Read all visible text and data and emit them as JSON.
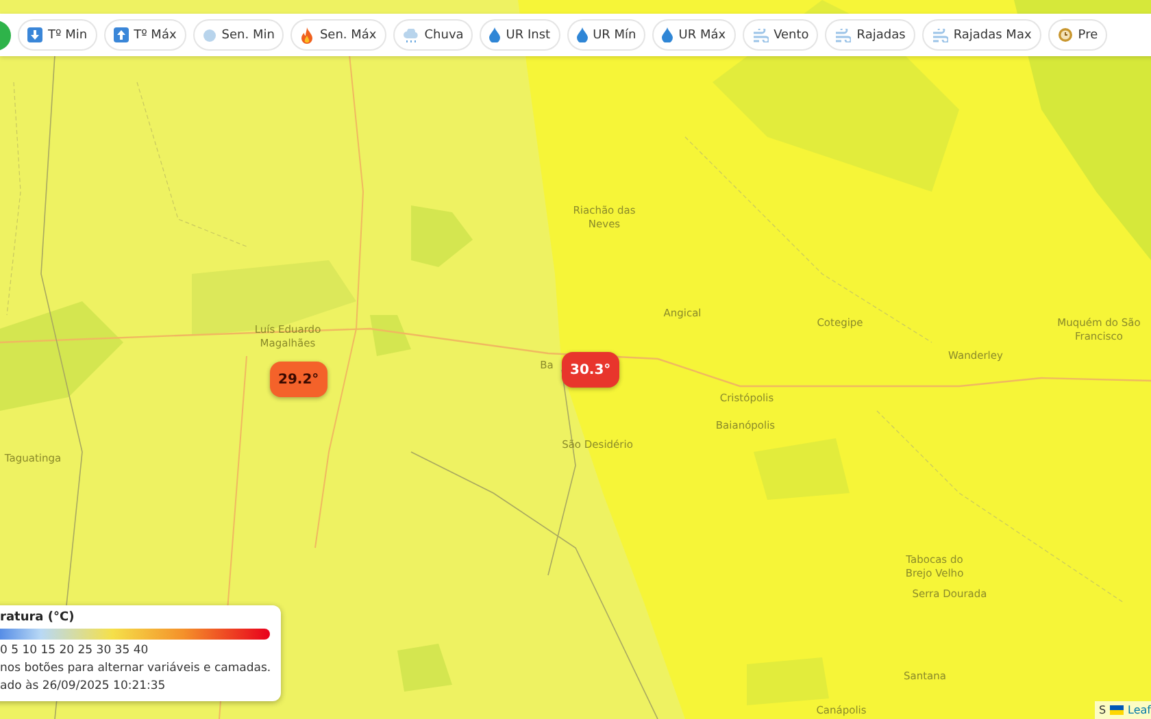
{
  "toolbar": {
    "buttons": [
      {
        "label": "Tº Min",
        "kind": "arrow-down",
        "selected": false
      },
      {
        "label": "Tº Máx",
        "kind": "arrow-up",
        "selected": false
      },
      {
        "label": "Sen. Min",
        "kind": "snow",
        "selected": false
      },
      {
        "label": "Sen. Máx",
        "kind": "flame",
        "selected": false
      },
      {
        "label": "Chuva",
        "kind": "cloud",
        "selected": false
      },
      {
        "label": "UR Inst",
        "kind": "drop",
        "selected": false
      },
      {
        "label": "UR Mín",
        "kind": "drop",
        "selected": false
      },
      {
        "label": "UR Máx",
        "kind": "drop",
        "selected": false
      },
      {
        "label": "Vento",
        "kind": "wind",
        "selected": false
      },
      {
        "label": "Rajadas",
        "kind": "wind",
        "selected": false
      },
      {
        "label": "Rajadas Max",
        "kind": "wind",
        "selected": false
      },
      {
        "label": "Pre",
        "kind": "clock",
        "selected": false
      }
    ]
  },
  "map": {
    "places": [
      {
        "name": "Riachão das Neves"
      },
      {
        "name": "Luís Eduardo Magalhães"
      },
      {
        "name": "Angical"
      },
      {
        "name": "Cotegipe"
      },
      {
        "name": "Muquém do São Francisco"
      },
      {
        "name": "Wanderley"
      },
      {
        "name": "Ba"
      },
      {
        "name": "Cristópolis"
      },
      {
        "name": "Baianópolis"
      },
      {
        "name": "São Desidério"
      },
      {
        "name": "Taguatinga"
      },
      {
        "name": "Tabocas do Brejo Velho"
      },
      {
        "name": "Serra Dourada"
      },
      {
        "name": "Santana"
      },
      {
        "name": "Canápolis"
      }
    ],
    "markers": [
      {
        "value": "29.2°",
        "color": "#f4622a"
      },
      {
        "value": "30.3°",
        "color": "#e8352c"
      }
    ]
  },
  "legend": {
    "title": "ratura (°C)",
    "scale": "0 5 10 15 20 25 30 35 40",
    "hint": "nos botões para alternar variáveis e camadas.",
    "updated": "ado às 26/09/2025 10:21:35"
  },
  "attribution": {
    "prefix": "S",
    "link": "Leaf"
  }
}
